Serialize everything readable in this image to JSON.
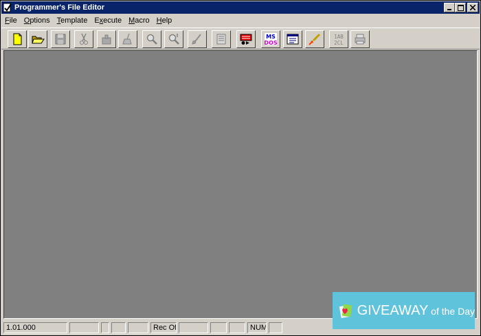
{
  "window": {
    "title": "Programmer's File Editor"
  },
  "menu": [
    {
      "label": "File",
      "accel": "F"
    },
    {
      "label": "Options",
      "accel": "O"
    },
    {
      "label": "Template",
      "accel": "T"
    },
    {
      "label": "Execute",
      "accel": "x"
    },
    {
      "label": "Macro",
      "accel": "M"
    },
    {
      "label": "Help",
      "accel": "H"
    }
  ],
  "toolbar": [
    "new-file-icon",
    "open-folder-icon",
    "save-disk-icon",
    "cut-scissors-icon",
    "paste-clipboard-icon",
    "undo-broom-icon",
    "find-magnifier-icon",
    "find-next-icon",
    "edit-brush-icon",
    "page-notes-icon",
    "record-macro-icon",
    "msdos-icon",
    "window-list-icon",
    "rocket-icon",
    "sort-1ab-icon",
    "print-icon"
  ],
  "toolbar_labels": {
    "msdos_top": "MS",
    "msdos_bottom": "DOS",
    "sort_top": "1AB",
    "sort_bottom": "2CL"
  },
  "status": {
    "version": "1.01.000",
    "rec": "Rec Off",
    "num": "NUM"
  },
  "badge": {
    "main": "GIVEAWAY",
    "small": " of the Day"
  },
  "colors": {
    "titlebar": "#0a246a",
    "client": "#808080",
    "face": "#d4d0c8",
    "badge": "#5fc3dc"
  }
}
